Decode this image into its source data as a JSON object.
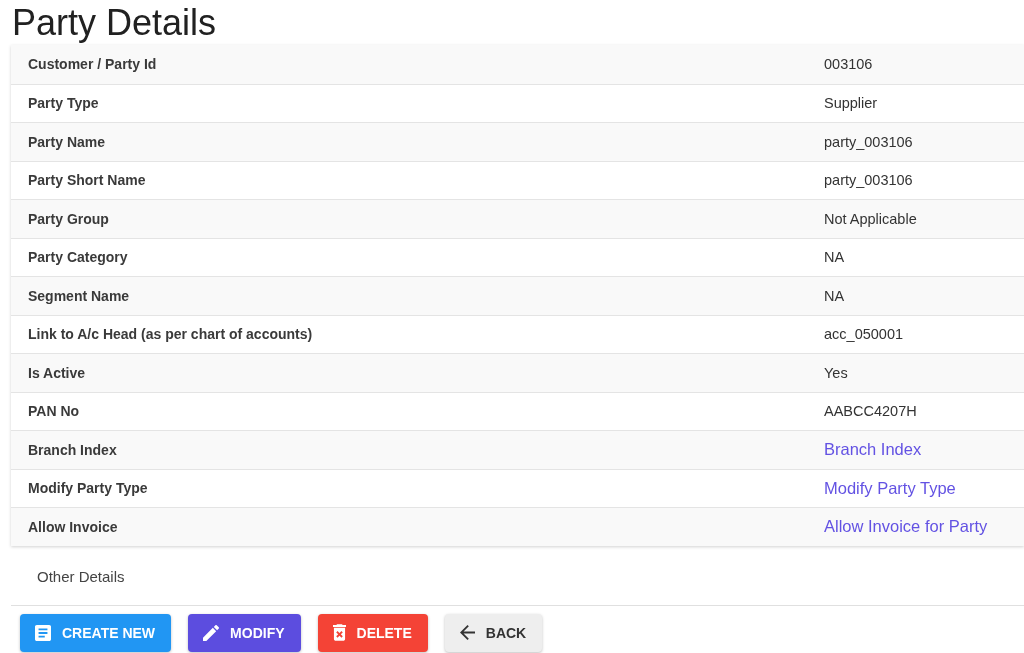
{
  "page": {
    "title": "Party Details"
  },
  "details": [
    {
      "label": "Customer / Party Id",
      "value": "003106",
      "kind": "text"
    },
    {
      "label": "Party Type",
      "value": "Supplier",
      "kind": "text"
    },
    {
      "label": "Party Name",
      "value": "party_003106",
      "kind": "text"
    },
    {
      "label": "Party Short Name",
      "value": "party_003106",
      "kind": "text"
    },
    {
      "label": "Party Group",
      "value": "Not Applicable",
      "kind": "text"
    },
    {
      "label": "Party Category",
      "value": "NA",
      "kind": "text"
    },
    {
      "label": "Segment Name",
      "value": "NA",
      "kind": "text"
    },
    {
      "label": "Link to A/c Head (as per chart of accounts)",
      "value": "acc_050001",
      "kind": "text"
    },
    {
      "label": "Is Active",
      "value": "Yes",
      "kind": "text"
    },
    {
      "label": "PAN No",
      "value": "AABCC4207H",
      "kind": "text"
    },
    {
      "label": "Branch Index",
      "value": "Branch Index",
      "kind": "link"
    },
    {
      "label": "Modify Party Type",
      "value": "Modify Party Type",
      "kind": "link"
    },
    {
      "label": "Allow Invoice",
      "value": "Allow Invoice for Party",
      "kind": "link"
    }
  ],
  "other_details": {
    "title": "Other Details"
  },
  "buttons": [
    {
      "label": "CREATE NEW",
      "kind": "create",
      "color": "#2196f3"
    },
    {
      "label": "MODIFY",
      "kind": "modify",
      "color": "#5c4ddf"
    },
    {
      "label": "DELETE",
      "kind": "delete",
      "color": "#f44336"
    },
    {
      "label": "BACK",
      "kind": "back",
      "color": "#eeeeee"
    }
  ]
}
